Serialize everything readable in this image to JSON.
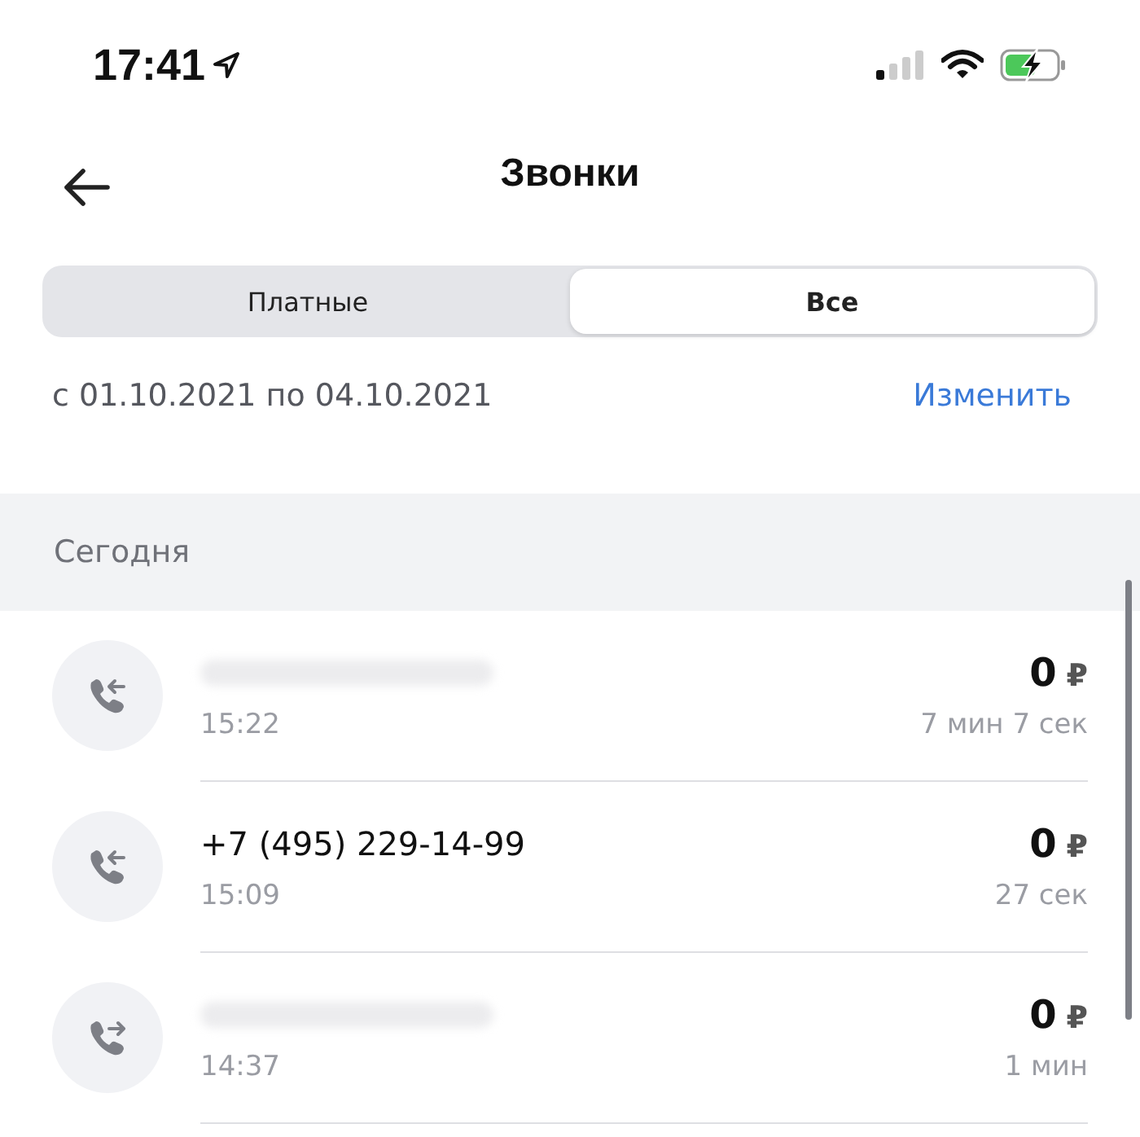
{
  "status_bar": {
    "time": "17:41"
  },
  "header": {
    "title": "Звонки"
  },
  "segments": [
    {
      "label": "Платные",
      "selected": false
    },
    {
      "label": "Все",
      "selected": true
    }
  ],
  "period": {
    "text": "с 01.10.2021 по 04.10.2021",
    "action": "Изменить"
  },
  "section": {
    "title": "Сегодня"
  },
  "calls": [
    {
      "kind": "incoming",
      "redacted": true,
      "time": "15:22",
      "amount": "0",
      "currency": "₽",
      "duration": "7 мин 7 сек"
    },
    {
      "kind": "incoming",
      "redacted": false,
      "number": "+7 (495) 229-14-99",
      "time": "15:09",
      "amount": "0",
      "currency": "₽",
      "duration": "27 сек"
    },
    {
      "kind": "outgoing",
      "redacted": true,
      "time": "14:37",
      "amount": "0",
      "currency": "₽",
      "duration": "1 мин"
    }
  ]
}
